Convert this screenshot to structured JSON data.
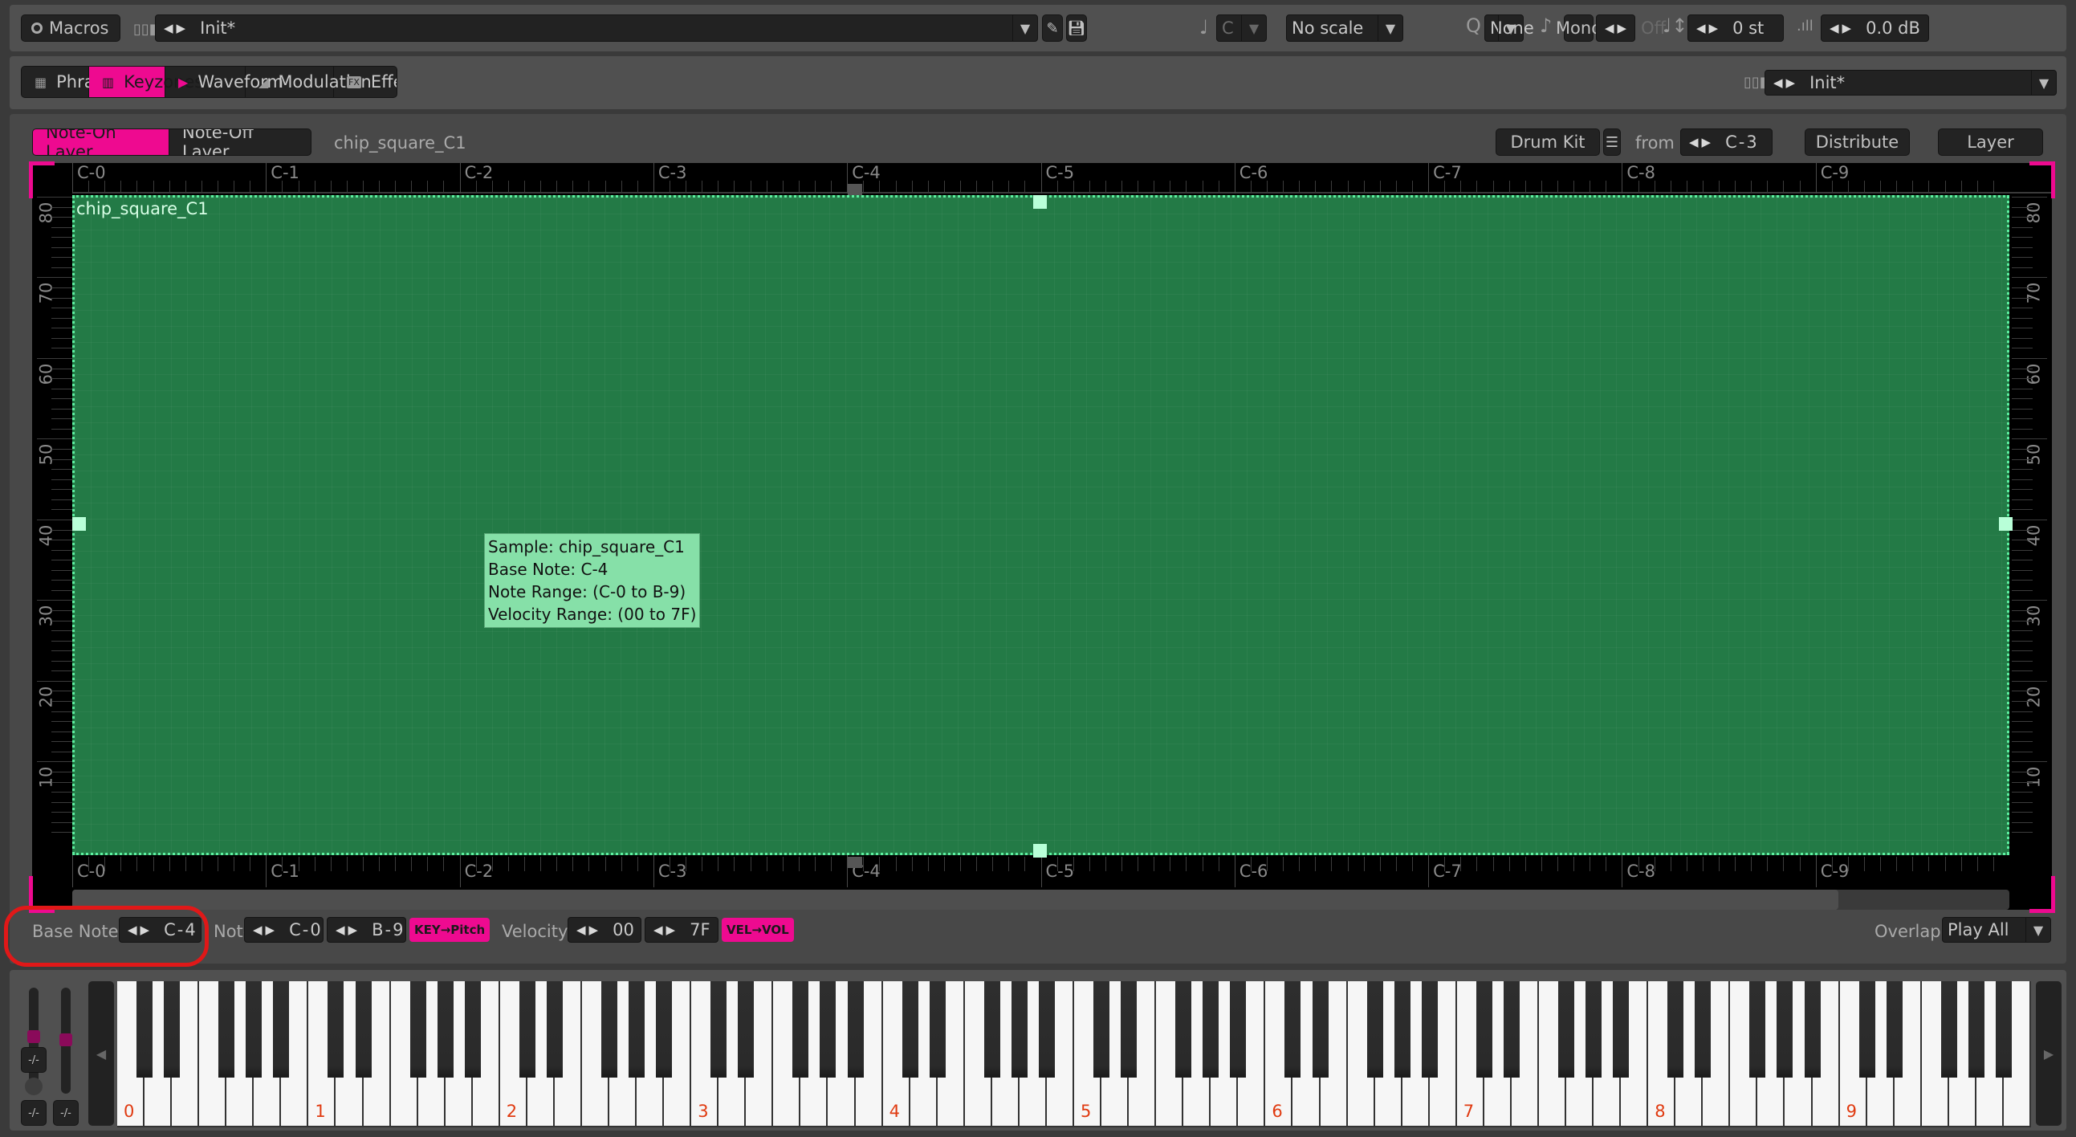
{
  "toolbar": {
    "macros_label": "Macros",
    "instrument_name": "Init*",
    "key_value": "C",
    "scale_value": "No scale",
    "quantize_value": "None",
    "mono_label": "Mono",
    "glide_value": "Off",
    "transpose_value": "0 st",
    "volume_value": "0.0 dB"
  },
  "tabs": [
    {
      "label": "Phrases",
      "icon": "grid-icon",
      "active": false
    },
    {
      "label": "Keyzones",
      "icon": "keys-icon",
      "active": true
    },
    {
      "label": "Waveform",
      "icon": "waveform-icon",
      "active": false
    },
    {
      "label": "Modulation",
      "icon": "envelope-icon",
      "active": false
    },
    {
      "label": "Effects",
      "icon": "fx-icon",
      "active": false
    }
  ],
  "preset": {
    "value": "Init*"
  },
  "layer_bar": {
    "note_on_label": "Note-On Layer",
    "note_off_label": "Note-Off Layer",
    "sample_name": "chip_square_C1",
    "drum_kit_label": "Drum Kit",
    "from_label": "from",
    "from_value": "C-3",
    "distribute_label": "Distribute",
    "layer_label": "Layer"
  },
  "keyzone": {
    "octave_labels": [
      "C-0",
      "C-1",
      "C-2",
      "C-3",
      "C-4",
      "C-5",
      "C-6",
      "C-7",
      "C-8",
      "C-9"
    ],
    "velocity_labels": [
      "80",
      "70",
      "60",
      "50",
      "40",
      "30",
      "20",
      "10"
    ],
    "zone_name": "chip_square_C1",
    "zone_note_range": [
      "C-0",
      "B-9"
    ],
    "zone_velocity_range": [
      "00",
      "7F"
    ],
    "base_note_octave": 4,
    "tooltip": [
      "Sample: chip_square_C1",
      "Base Note: C-4",
      "Note Range: (C-0 to B-9)",
      "Velocity Range: (00 to 7F)"
    ],
    "colors": {
      "zone": "#237a46",
      "zone_border": "#5cf0a0",
      "accent": "#ee0a90",
      "tooltip_bg": "#86e0a8"
    }
  },
  "controls": {
    "base_note_label": "Base Note",
    "base_note_value": "C-4",
    "note_label": "Note",
    "note_low": "C-0",
    "note_high": "B-9",
    "key_pitch_label": "KEY→Pitch",
    "velocity_label": "Velocity",
    "vel_low": "00",
    "vel_high": "7F",
    "vel_vol_label": "VEL→VOL",
    "overlap_label": "Overlap",
    "overlap_value": "Play All"
  },
  "keyboard": {
    "octave_numbers": [
      "0",
      "1",
      "2",
      "3",
      "4",
      "5",
      "6",
      "7",
      "8",
      "9"
    ]
  }
}
